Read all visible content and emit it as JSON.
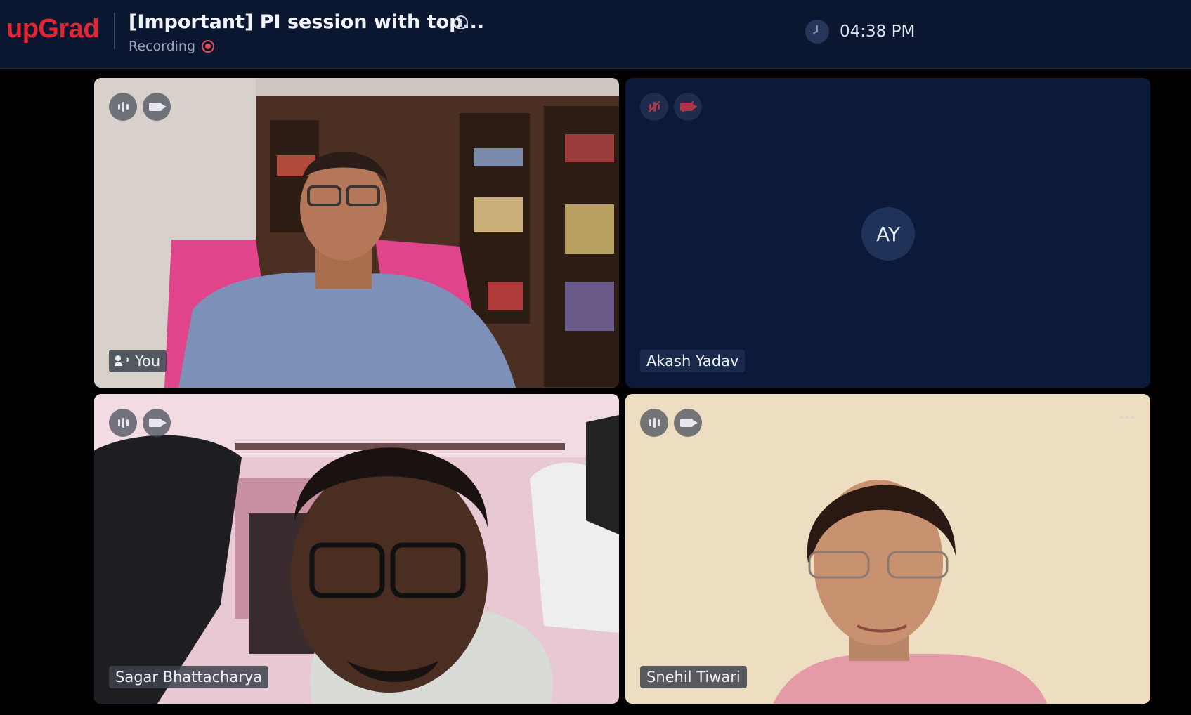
{
  "header": {
    "logo": "upGrad",
    "title": "[Important] PI session with top...",
    "recording_label": "Recording",
    "time": "04:38 PM"
  },
  "tiles": [
    {
      "name": "You",
      "mic": "on",
      "camera": "on",
      "speaking": true
    },
    {
      "name": "Akash Yadav",
      "initials": "AY",
      "mic": "off",
      "camera": "off"
    },
    {
      "name": "Sagar Bhattacharya",
      "mic": "on",
      "camera": "on",
      "more_menu": "···"
    },
    {
      "name": "Snehil Tiwari",
      "mic": "on",
      "camera": "on",
      "more_menu": "···"
    }
  ],
  "icons": {
    "info": "info-icon",
    "recording": "recording-dot-icon",
    "clock": "clock-icon",
    "mic": "mic-icon",
    "camera": "camera-icon",
    "more": "more-options-icon",
    "speaker": "active-speaker-icon"
  },
  "colors": {
    "brand": "#e4242f",
    "header_bg": "#0b1731",
    "recording": "#e04b5a",
    "muted": "#b03545",
    "tile_placeholder": "#0b1a3a"
  }
}
